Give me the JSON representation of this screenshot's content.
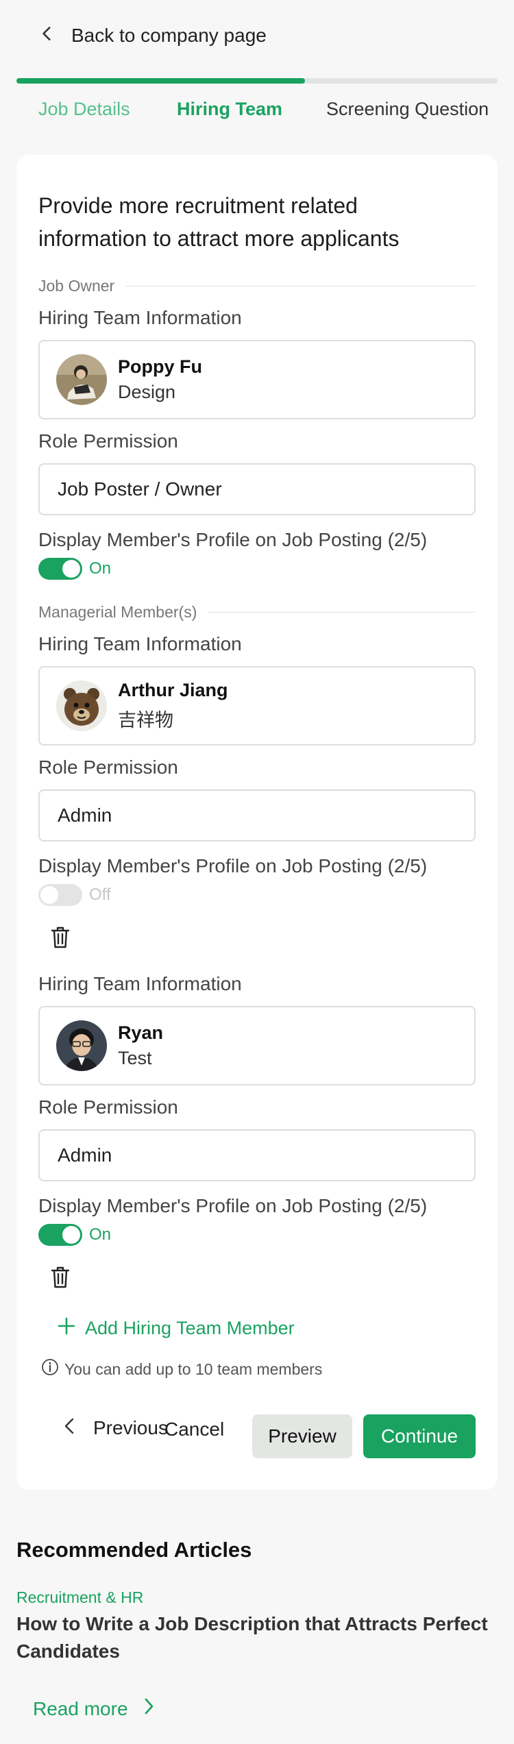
{
  "header": {
    "back_label": "Back to company page"
  },
  "progress": {
    "fraction": 0.6
  },
  "tabs": [
    {
      "label": "Job Details",
      "state": "done"
    },
    {
      "label": "Hiring Team",
      "state": "active"
    },
    {
      "label": "Screening Question",
      "state": "pending"
    }
  ],
  "form": {
    "intro": "Provide more recruitment related information to attract more applicants",
    "job_owner_heading": "Job Owner",
    "managerial_heading": "Managerial Member(s)",
    "hiring_info_label": "Hiring Team Information",
    "role_permission_label": "Role Permission",
    "display_profile_label": "Display Member's Profile on Job Posting (2/5)",
    "on_text": "On",
    "off_text": "Off",
    "owner": {
      "name": "Poppy Fu",
      "department": "Design",
      "role": "Job Poster / Owner",
      "display": true
    },
    "members": [
      {
        "name": "Arthur Jiang",
        "department": "吉祥物",
        "role": "Admin",
        "display": false
      },
      {
        "name": "Ryan",
        "department": "Test",
        "role": "Admin",
        "display": true
      }
    ],
    "add_member_label": "Add Hiring Team Member",
    "limit_note": "You can add up to 10 team members",
    "previous_label": "Previous",
    "cancel_label": "Cancel",
    "preview_label": "Preview",
    "continue_label": "Continue"
  },
  "articles": {
    "heading": "Recommended Articles",
    "items": [
      {
        "category": "Recruitment & HR",
        "title": "How to Write a Job Description that Attracts Perfect Candidates",
        "cta": "Read more"
      }
    ]
  },
  "colors": {
    "accent": "#1aa260",
    "accent_light": "#55c08a",
    "page_bg": "#f7f7f7",
    "toggle_off": "#e4e4e4"
  }
}
